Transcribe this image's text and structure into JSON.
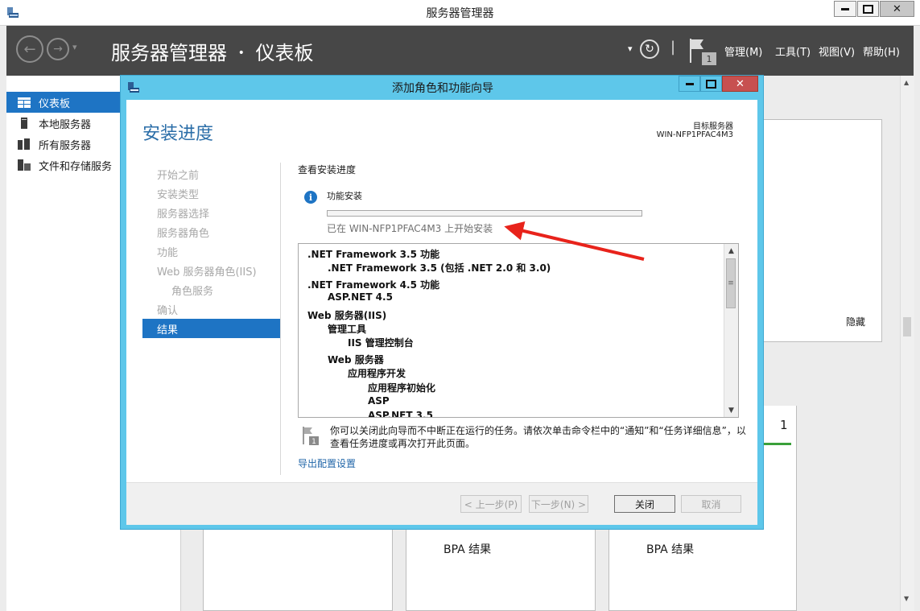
{
  "outer_window": {
    "title": "服务器管理器",
    "minimize": "▬",
    "maximize": "□",
    "close": "✕"
  },
  "header": {
    "breadcrumb_app": "服务器管理器",
    "breadcrumb_sep": "•",
    "breadcrumb_page": "仪表板",
    "notification_count": "1",
    "menus": [
      "管理(M)",
      "工具(T)",
      "视图(V)",
      "帮助(H)"
    ],
    "dropdown_arrow": "▾",
    "separator": "|"
  },
  "sidebar": {
    "items": [
      {
        "label": "仪表板",
        "icon": "dashboard-icon",
        "active": true
      },
      {
        "label": "本地服务器",
        "icon": "local-server-icon"
      },
      {
        "label": "所有服务器",
        "icon": "all-servers-icon"
      },
      {
        "label": "文件和存储服务",
        "icon": "file-storage-icon"
      }
    ]
  },
  "dashboard_bg": {
    "hide_label": "隐藏",
    "tile_count": "1",
    "bpa_label_1": "BPA 结果",
    "bpa_label_2": "BPA 结果"
  },
  "dialog": {
    "title": "添加角色和功能向导",
    "heading": "安装进度",
    "target_label": "目标服务器",
    "target_server": "WIN-NFP1PFAC4M3",
    "steps": [
      "开始之前",
      "安装类型",
      "服务器选择",
      "服务器角色",
      "功能",
      "Web 服务器角色(IIS)",
      "角色服务",
      "确认"
    ],
    "active_step": "结果",
    "view_progress": "查看安装进度",
    "feature_install": "功能安装",
    "progress_fraction": 0.0,
    "install_started": "已在 WIN-NFP1PFAC4M3 上开始安装",
    "install_list": [
      {
        "text": ".NET Framework 3.5 功能",
        "level": 0
      },
      {
        "text": ".NET Framework 3.5 (包括 .NET 2.0 和 3.0)",
        "level": 1
      },
      {
        "text": ".NET Framework 4.5 功能",
        "level": 0
      },
      {
        "text": "ASP.NET 4.5",
        "level": 1
      },
      {
        "text": "Web 服务器(IIS)",
        "level": 0
      },
      {
        "text": "管理工具",
        "level": 1
      },
      {
        "text": "IIS 管理控制台",
        "level": 2
      },
      {
        "text": "Web 服务器",
        "level": 1
      },
      {
        "text": "应用程序开发",
        "level": 2
      },
      {
        "text": "应用程序初始化",
        "level": 3
      },
      {
        "text": "ASP",
        "level": 3
      },
      {
        "text": "ASP.NET 3.5",
        "level": 3
      }
    ],
    "notice_line1": "你可以关闭此向导而不中断正在运行的任务。请依次单击命令栏中的“通知”和“任务详细信息”，以",
    "notice_line2": "查看任务进度或再次打开此页面。",
    "export_link": "导出配置设置",
    "btn_prev": "< 上一步(P)",
    "btn_next": "下一步(N) >",
    "btn_close": "关闭",
    "btn_cancel": "取消"
  },
  "colors": {
    "header_bg": "#474747",
    "accent_blue": "#1e74c4",
    "dialog_frame": "#5ec7ea",
    "arrow_red": "#e8231b"
  }
}
